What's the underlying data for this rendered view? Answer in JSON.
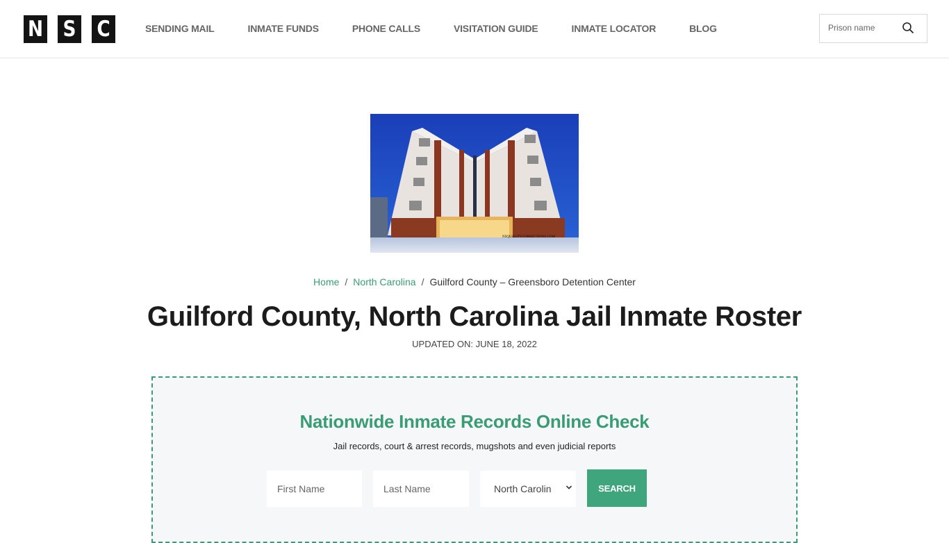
{
  "header": {
    "logo_letters": [
      "N",
      "S",
      "C"
    ],
    "nav": [
      {
        "label": "SENDING MAIL"
      },
      {
        "label": "INMATE FUNDS"
      },
      {
        "label": "PHONE CALLS"
      },
      {
        "label": "VISITATION GUIDE"
      },
      {
        "label": "INMATE LOCATOR"
      },
      {
        "label": "BLOG"
      }
    ],
    "search": {
      "placeholder": "Prison name",
      "icon": "search-icon"
    }
  },
  "hero": {
    "image_alt": "Guilford County Greensboro Detention Center building at dusk",
    "watermark": "NSQUALITYCORRECTIONS.COM"
  },
  "breadcrumb": [
    {
      "label": "Home",
      "link": true
    },
    {
      "label": "North Carolina",
      "link": true
    },
    {
      "label": "Guilford County – Greensboro Detention Center",
      "link": false
    }
  ],
  "page": {
    "title": "Guilford County, North Carolina Jail Inmate Roster",
    "updated": "UPDATED ON: JUNE 18, 2022"
  },
  "records": {
    "title": "Nationwide Inmate Records Online Check",
    "subtitle": "Jail records, court & arrest records, mugshots and even judicial reports",
    "first_name_placeholder": "First Name",
    "last_name_placeholder": "Last Name",
    "state_selected": "North Carolin",
    "search_label": "SEARCH"
  },
  "colors": {
    "accent": "#3a9c74",
    "button": "#3fa57c",
    "logo_bg": "#141414"
  }
}
